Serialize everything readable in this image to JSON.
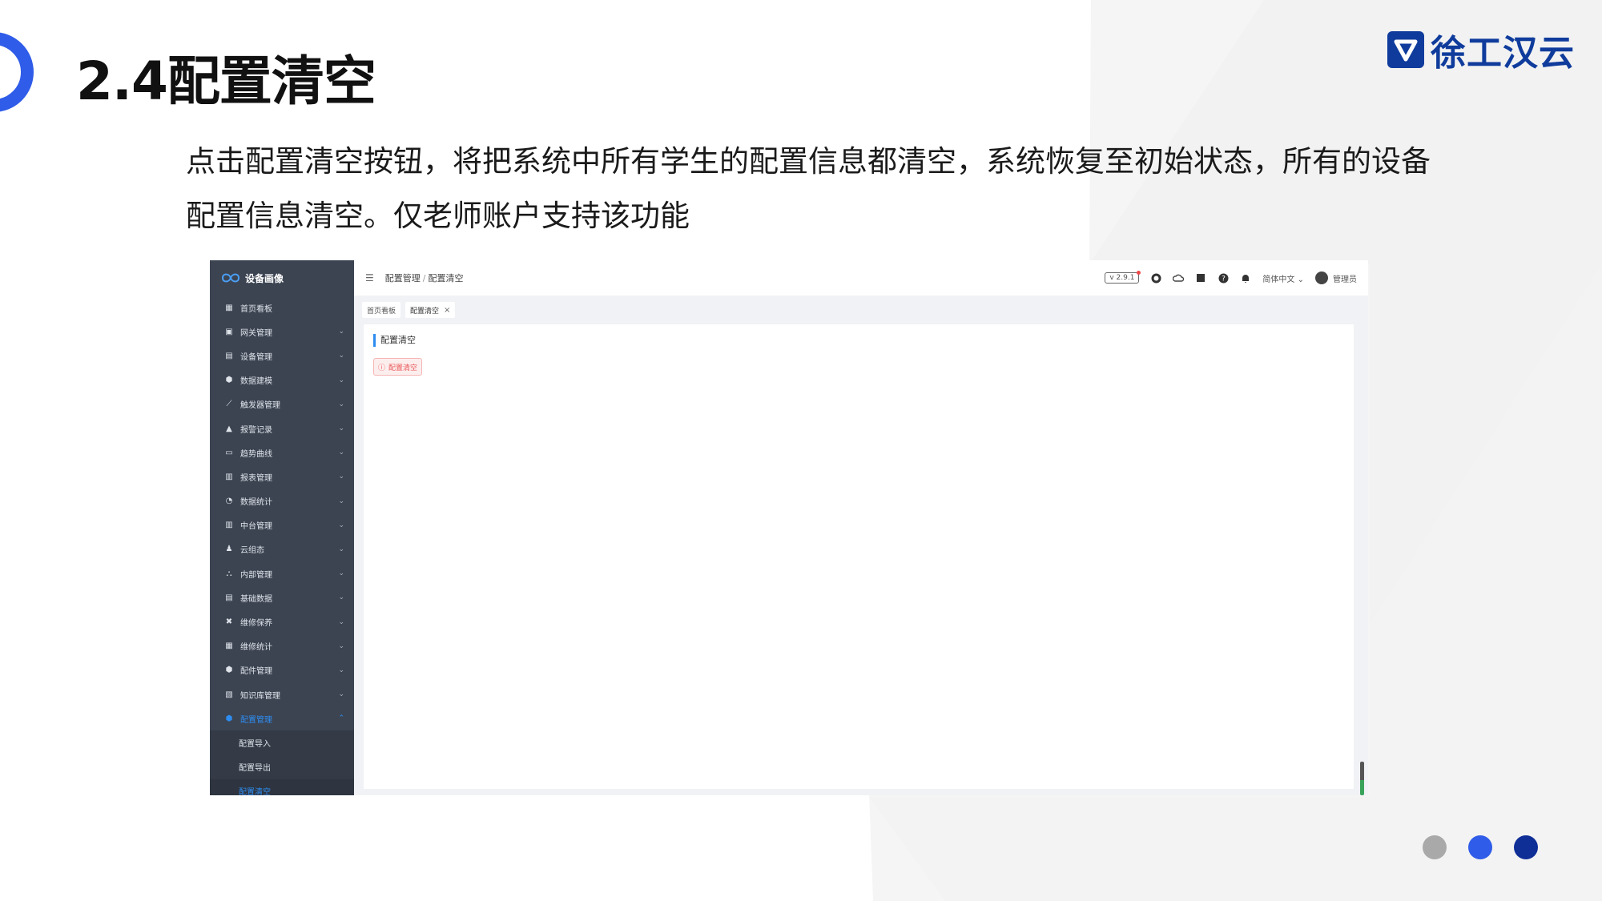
{
  "slide": {
    "title": "2.4配置清空",
    "brand": "徐工汉云",
    "description": "点击配置清空按钮，将把系统中所有学生的配置信息都清空，系统恢复至初始状态，所有的设备配置信息清空。仅老师账户支持该功能",
    "dot_colors": [
      "#a9a9a9",
      "#2f5ce8",
      "#0f2e96"
    ]
  },
  "app": {
    "logo_text": "设备画像",
    "menu": [
      {
        "label": "首页看板",
        "icon": "dashboard-icon",
        "arrow": ""
      },
      {
        "label": "网关管理",
        "icon": "gateway-icon",
        "arrow": "⌄"
      },
      {
        "label": "设备管理",
        "icon": "device-icon",
        "arrow": "⌄"
      },
      {
        "label": "数据建模",
        "icon": "model-icon",
        "arrow": "⌄"
      },
      {
        "label": "触发器管理",
        "icon": "trigger-icon",
        "arrow": "⌄"
      },
      {
        "label": "报警记录",
        "icon": "alarm-icon",
        "arrow": "⌄"
      },
      {
        "label": "趋势曲线",
        "icon": "trend-icon",
        "arrow": "⌄"
      },
      {
        "label": "报表管理",
        "icon": "report-icon",
        "arrow": "⌄"
      },
      {
        "label": "数据统计",
        "icon": "stats-icon",
        "arrow": "⌄"
      },
      {
        "label": "中台管理",
        "icon": "platform-icon",
        "arrow": "⌄"
      },
      {
        "label": "云组态",
        "icon": "cloud-config-icon",
        "arrow": "⌄"
      },
      {
        "label": "内部管理",
        "icon": "org-icon",
        "arrow": "⌄"
      },
      {
        "label": "基础数据",
        "icon": "base-data-icon",
        "arrow": "⌄"
      },
      {
        "label": "维修保养",
        "icon": "maintenance-icon",
        "arrow": "⌄"
      },
      {
        "label": "维修统计",
        "icon": "repair-stats-icon",
        "arrow": "⌄"
      },
      {
        "label": "配件管理",
        "icon": "parts-icon",
        "arrow": "⌄"
      },
      {
        "label": "知识库管理",
        "icon": "knowledge-icon",
        "arrow": "⌄"
      },
      {
        "label": "配置管理",
        "icon": "config-icon",
        "arrow": "⌃"
      }
    ],
    "submenu": [
      "配置导入",
      "配置导出",
      "配置清空"
    ],
    "breadcrumb": {
      "parent": "配置管理",
      "sep": "/",
      "current": "配置清空"
    },
    "version": "v 2.9.1",
    "language": "简体中文",
    "language_arrow": "⌄",
    "user": "管理员",
    "tabs": [
      {
        "label": "首页看板",
        "closable": false
      },
      {
        "label": "配置清空",
        "closable": true,
        "close": "×"
      }
    ],
    "card_title": "配置清空",
    "clear_button": "配置清空",
    "clear_icon": "ⓘ"
  }
}
